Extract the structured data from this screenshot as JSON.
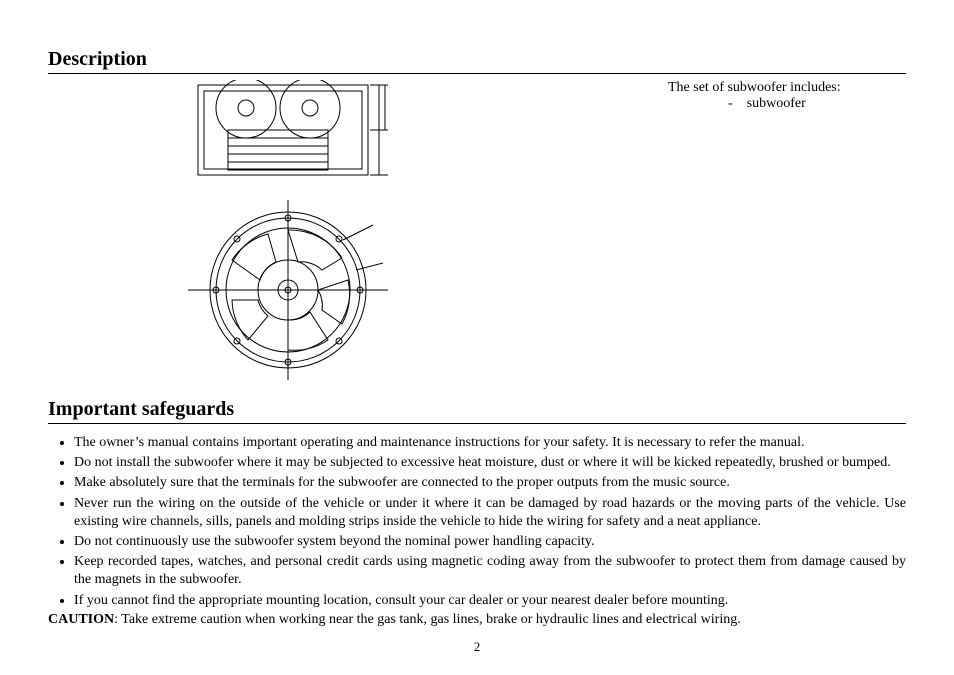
{
  "sections": {
    "description": {
      "title": "Description",
      "includesLine": "The set of subwoofer includes:",
      "includesItemDash": "-",
      "includesItem": "subwoofer"
    },
    "safeguards": {
      "title": "Important safeguards",
      "bullets": [
        "The owner’s manual contains important operating and maintenance instructions for your safety. It is necessary to refer the manual.",
        "Do not install the subwoofer where it may be subjected to excessive heat moisture, dust or where it will be kicked repeatedly, brushed or bumped.",
        "Make absolutely sure that the terminals for the subwoofer are connected to the proper outputs from the music source.",
        "Never run the wiring on the outside of the vehicle or under it where it can be damaged by road hazards or the moving parts of the vehicle. Use existing wire channels, sills, panels and molding strips inside the vehicle to hide the wiring for safety and a neat appliance.",
        "Do not continuously use the subwoofer system beyond the nominal power handling capacity.",
        "Keep recorded tapes, watches, and personal credit cards using magnetic coding away from the subwoofer to protect them from damage caused by the magnets in the subwoofer.",
        "If you cannot find the appropriate mounting location, consult your car dealer or your nearest dealer before mounting."
      ],
      "cautionLabel": "CAUTION",
      "cautionText": ": Take extreme caution when working near the gas tank, gas lines, brake or hydraulic lines and electrical wiring."
    }
  },
  "pageNumber": "2"
}
